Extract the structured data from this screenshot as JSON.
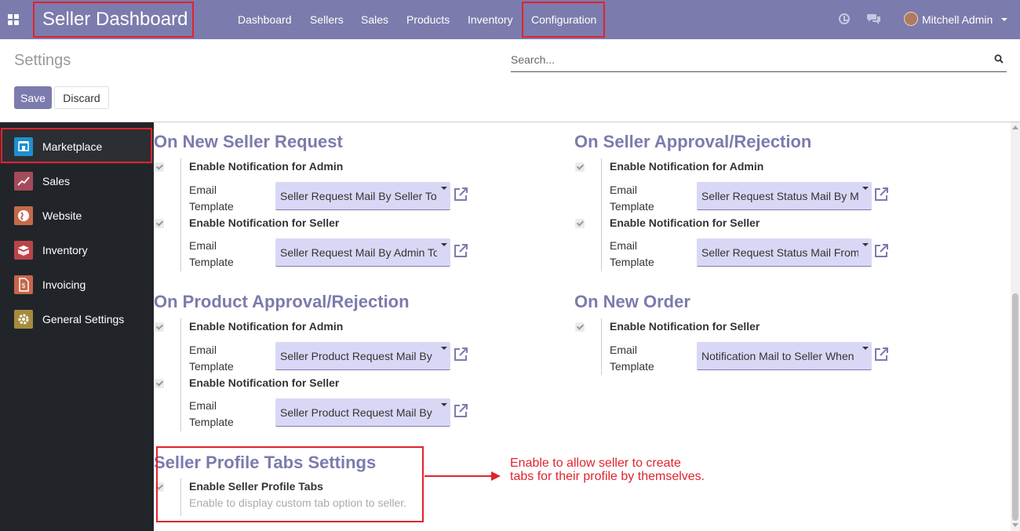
{
  "navbar": {
    "brand": "Seller Dashboard",
    "menu": [
      {
        "label": "Dashboard"
      },
      {
        "label": "Sellers"
      },
      {
        "label": "Sales"
      },
      {
        "label": "Products"
      },
      {
        "label": "Inventory"
      },
      {
        "label": "Configuration"
      }
    ],
    "user": "Mitchell Admin"
  },
  "control_panel": {
    "title": "Settings",
    "search_placeholder": "Search...",
    "save_label": "Save",
    "discard_label": "Discard"
  },
  "sidebar": {
    "items": [
      {
        "label": "Marketplace",
        "icon": "marketplace-icon",
        "color": "#1f8fcf"
      },
      {
        "label": "Sales",
        "icon": "sales-icon",
        "color": "#a44a5a"
      },
      {
        "label": "Website",
        "icon": "website-icon",
        "color": "#c46a4a"
      },
      {
        "label": "Inventory",
        "icon": "inventory-icon",
        "color": "#b8444a"
      },
      {
        "label": "Invoicing",
        "icon": "invoicing-icon",
        "color": "#c8664a"
      },
      {
        "label": "General Settings",
        "icon": "gear-icon",
        "color": "#a68b3c"
      }
    ]
  },
  "sections": {
    "new_seller_request": {
      "title": "On New Seller Request",
      "admin_label": "Enable Notification for Admin",
      "admin_email_label": "Email Template",
      "admin_template": "Seller Request Mail By Seller To Admin",
      "seller_label": "Enable Notification for Seller",
      "seller_email_label": "Email Template",
      "seller_template": "Seller Request Mail By Admin To Seller"
    },
    "seller_approval": {
      "title": "On Seller Approval/Rejection",
      "admin_label": "Enable Notification for Admin",
      "admin_email_label": "Email Template",
      "admin_template": "Seller Request Status Mail By Me",
      "seller_label": "Enable Notification for Seller",
      "seller_email_label": "Email Template",
      "seller_template": "Seller Request Status Mail From"
    },
    "product_approval": {
      "title": "On Product Approval/Rejection",
      "admin_label": "Enable Notification for Admin",
      "admin_email_label": "Email Template",
      "admin_template": "Seller Product Request Mail By",
      "seller_label": "Enable Notification for Seller",
      "seller_email_label": "Email Template",
      "seller_template": "Seller Product Request Mail By"
    },
    "new_order": {
      "title": "On New Order",
      "seller_label": "Enable Notification for Seller",
      "seller_email_label": "Email Template",
      "seller_template": "Notification Mail to Seller When"
    },
    "profile_tabs": {
      "title": "Seller Profile Tabs Settings",
      "label": "Enable Seller Profile Tabs",
      "description": "Enable to display custom tab option to seller."
    }
  },
  "annotation": {
    "line1": "Enable to allow seller to create",
    "line2": "tabs for their profile by themselves."
  },
  "colors": {
    "brand": "#7c7bad",
    "highlight": "#e0232e",
    "select_bg": "#d8d8f6"
  }
}
